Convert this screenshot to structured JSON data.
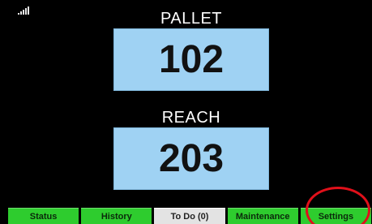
{
  "status_bar": {
    "signal_icon": "signal-strength-icon"
  },
  "pallet": {
    "label": "PALLET",
    "value": "102"
  },
  "reach": {
    "label": "REACH",
    "value": "203"
  },
  "nav": {
    "tabs": [
      {
        "label": "Status",
        "active": false
      },
      {
        "label": "History",
        "active": false
      },
      {
        "label": "To Do (0)",
        "active": true
      },
      {
        "label": "Maintenance",
        "active": false
      },
      {
        "label": "Settings",
        "active": false
      }
    ]
  },
  "colors": {
    "background": "#000000",
    "value_box": "#9fd2f3",
    "tab_green": "#2ecc2e",
    "tab_active": "#e3e3e3",
    "highlight_ring": "#e0101a"
  }
}
